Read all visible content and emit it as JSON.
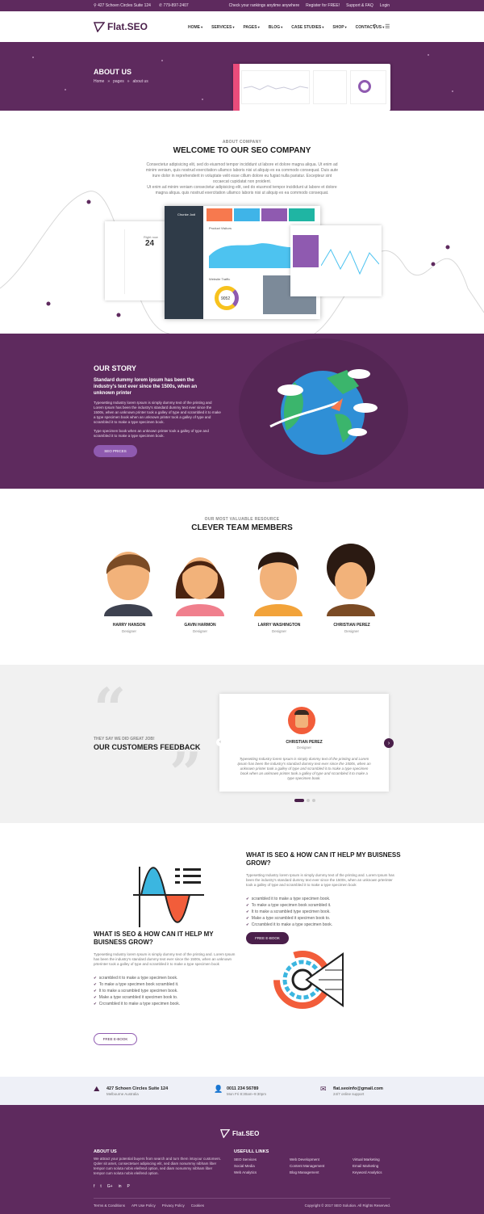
{
  "topbar": {
    "address": "427 Schoen Circles Suite 124",
    "phone": "779-897-2407",
    "rankings": "Check your rankings anytime anywhere",
    "register": "Register for FREE!",
    "support": "Support & FAQ",
    "login": "Login"
  },
  "header": {
    "logo": "Flat.SEO",
    "nav": [
      "HOME",
      "SERVICES",
      "PAGES",
      "BLOG",
      "CASE STUDIES",
      "SHOP",
      "CONTACT US"
    ]
  },
  "hero": {
    "title": "ABOUT US",
    "breadcrumb": [
      "Home",
      "pages",
      "about us"
    ]
  },
  "about": {
    "kicker": "ABOUT COMPANY",
    "title": "WELCOME TO OUR SEO COMPANY",
    "para1": "Consectetur adipisicing elit, sed do eiusmod tempor incididunt ut labore et dolore magna aliqua. Ut enim ad minim veniam, quis nostrud exercitation ullamco laboris nisi ut aliquip ex ea commodo consequat. Duis aute irure dolor in reprehenderit in voluptate velit esse cillum dolore eu fugiat nulla pariatur. Excepteur sint occaecat cupidatat non proident.",
    "para2": "Ut enim ad minim veniam consectetur adipisicing elit, sed do eiusmod tempor incididunt ut labore et dolore magna aliqua. quis nostrud exercitation ullamco laboris nisi ut aliquip ex ea commodo consequat.",
    "mock": {
      "user": "Chunke Jodi",
      "date_label": "Right now",
      "date_num": "24",
      "chart_title": "Product Visitors",
      "traffic": "Website Traffic",
      "total": "9052"
    }
  },
  "story": {
    "title": "OUR STORY",
    "subtitle": "Standard dummy lorem ipsum has been the industry's text ever since the 1500s, when an unknown printer",
    "para1": "Typesetting Industry lorem Ipsum is simply dummy text of the printing and Lorem Ipsum has been the industry's standard dummy text ever since the 1500s, when an unknown printer took a galley of type and scrambled it to make a type specimen book when an unknown printer took a galley of type and scrambled it to make a type specimen book.",
    "para2": "Type specimen book when an unknown printer took a galley of type and scrambled it to make a type specimen book.",
    "button": "SEO PRICES"
  },
  "team": {
    "kicker": "OUR MOST VALUABLE RESOURCE",
    "title": "CLEVER TEAM MEMBERS",
    "members": [
      {
        "name": "HARRY HANSON",
        "role": "Designer"
      },
      {
        "name": "GAVIN HARMON",
        "role": "Designer"
      },
      {
        "name": "LARRY WASHINGTON",
        "role": "Designer"
      },
      {
        "name": "CHRISTIAN PEREZ",
        "role": "Designer"
      }
    ]
  },
  "feedback": {
    "kicker": "THEY SAY WE DID GREAT JOB!",
    "title": "OUR CUSTOMERS FEEDBACK",
    "name": "CHRISTIAN PEREZ",
    "role": "Designer",
    "quote": "Typesetting Industry lorem Ipsum is simply dummy text of the printing and Lorem Ipsum has been the industry's standard dummy text ever since the 1500s, when an unknown printer took a galley of type and scrambled it to make a type specimen book when an unknown printer took a galley of type and scrambled it to make a type specimen book."
  },
  "seo1": {
    "title": "WHAT IS SEO & HOW CAN IT HELP MY BUISNESS GROW?",
    "para": "Typesetting Industry lorem Ipsum is simply dummy text of the printing and. Lorem Ipsum has been the industry's standard dummy text ever since the 1500s, when an unknown prterinter took a galley of type and scrambled it to make a type specimen book",
    "list": [
      "scrambled it to make a type specimen book.",
      "To make a type specimen book scrambled it.",
      "It to make a scrambled type specimen book.",
      "Make a type scrambled it specimen book to.",
      "Crcrambled it to make a type specimen book."
    ],
    "button": "FREE E-BOOK"
  },
  "seo2": {
    "title": "WHAT IS SEO & HOW CAN IT HELP MY BUISNESS GROW?",
    "para": "Typesetting Industry lorem Ipsum is simply dummy text of the printing and. Lorem Ipsum has been the industry's standard dummy text ever since the 1500s, when an unknown prterinter took a galley of type and scrambled it to make a type specimen book",
    "list": [
      "scrambled it to make a type specimen book.",
      "To make a type specimen book scrambled it.",
      "It to make a scrambled type specimen book.",
      "Make a type scrambled it specimen book to.",
      "Crcrambled it to make a type specimen book."
    ],
    "button": "FREE E-BOOK"
  },
  "contact": {
    "address_line1": "427 Schoen Circles Suite 124",
    "address_line2": "Melbourne Australia",
    "phone_line1": "0011 234 56789",
    "phone_line2": "Mon Fri 8:30am–9:30pm",
    "email_line1": "flat.seoinfo@gmail.com",
    "email_line2": "24/7 online support"
  },
  "footer": {
    "logo": "Flat.SEO",
    "about_title": "ABOUT US",
    "about_text": "We attract your potential buyers from search and turn them intoyour customers. Qoler sit amet, consectetuer adipiscing elit, sed diam nonummy nibham liber tempor cum soluta nobis eleifend option, sed diam nonummy nibham liber tempor cum soluta nobis eleifend option.",
    "links_title": "USEFULL LINKS",
    "links_col1": [
      "SEO Services",
      "Social Media",
      "Web Analytics"
    ],
    "links_col2": [
      "Web Development",
      "Content Management",
      "Blog Management"
    ],
    "links_col3": [
      "Virtual Marketing",
      "Email Marketing",
      "Keyword Analytics"
    ],
    "bottom_links": [
      "Terms & Conditions",
      "API Use Policy",
      "Privacy Policy",
      "Cookies"
    ],
    "copyright": "Copyright © 2017 SEO Solution. All Rights Reserved."
  },
  "colors": {
    "primary": "#5e2a5e",
    "accent": "#8f5ab0",
    "highlight": "#e94c7b"
  }
}
